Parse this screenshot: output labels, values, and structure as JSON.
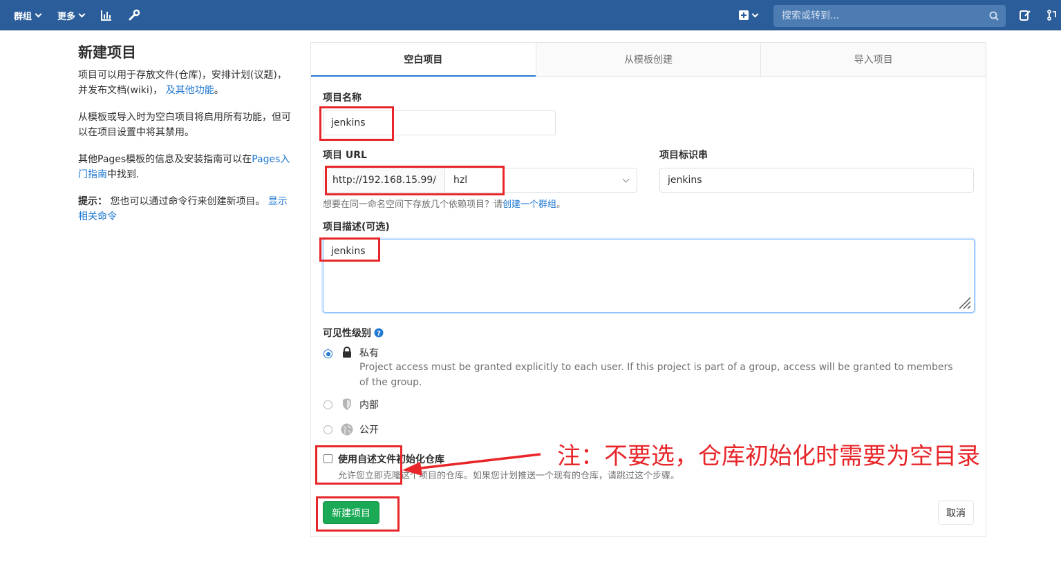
{
  "navbar": {
    "groups_label": "群组",
    "more_label": "更多",
    "search_placeholder": "搜索或转到..."
  },
  "sidebar_info": {
    "title": "新建项目",
    "para1_text": "项目可以用于存放文件(仓库)，安排计划(议题)，并发布文档(wiki)，",
    "para1_link": "及其他功能",
    "para1_end": "。",
    "para2_text": "从模板或导入时为空白项目将启用所有功能，但可以在项目设置中将其禁用。",
    "para3_text": "其他Pages模板的信息及安装指南可以在",
    "para3_link": "Pages入门指南",
    "para3_end": "中找到.",
    "tip_label": "提示：",
    "tip_text": "您也可以通过命令行来创建新项目。",
    "tip_link": "显示相关命令"
  },
  "tabs": [
    {
      "label": "空白项目",
      "active": true
    },
    {
      "label": "从模板创建",
      "active": false
    },
    {
      "label": "导入项目",
      "active": false
    }
  ],
  "form": {
    "name_label": "项目名称",
    "name_value": "jenkins",
    "url_label": "项目 URL",
    "url_prefix": "http://192.168.15.99/",
    "url_namespace": "hzl",
    "slug_label": "项目标识串",
    "slug_value": "jenkins",
    "url_help_text": "想要在同一命名空间下存放几个依赖项目？请",
    "url_help_link": "创建一个群组",
    "url_help_end": "。",
    "desc_label": "项目描述(可选)",
    "desc_value": "jenkins",
    "visibility_label": "可见性级别",
    "visibility_options": [
      {
        "label": "私有",
        "description": "Project access must be granted explicitly to each user. If this project is part of a group, access will be granted to members of the group.",
        "icon": "lock-icon",
        "checked": true
      },
      {
        "label": "内部",
        "description": "",
        "icon": "shield-icon",
        "checked": false
      },
      {
        "label": "公开",
        "description": "",
        "icon": "globe-icon",
        "checked": false
      }
    ],
    "init_readme_label": "使用自述文件初始化仓库",
    "init_readme_help": "允许您立即克隆这个项目的仓库。如果您计划推送一个现有的仓库，请跳过这个步骤。",
    "init_readme_checked": false,
    "create_button": "新建项目",
    "cancel_button": "取消"
  },
  "annotation": {
    "text": "注：不要选，仓库初始化时需要为空目录",
    "color": "#e8262a"
  },
  "colors": {
    "navbar": "#2b5d9b",
    "link": "#1f78d1",
    "success": "#1aaa55"
  }
}
